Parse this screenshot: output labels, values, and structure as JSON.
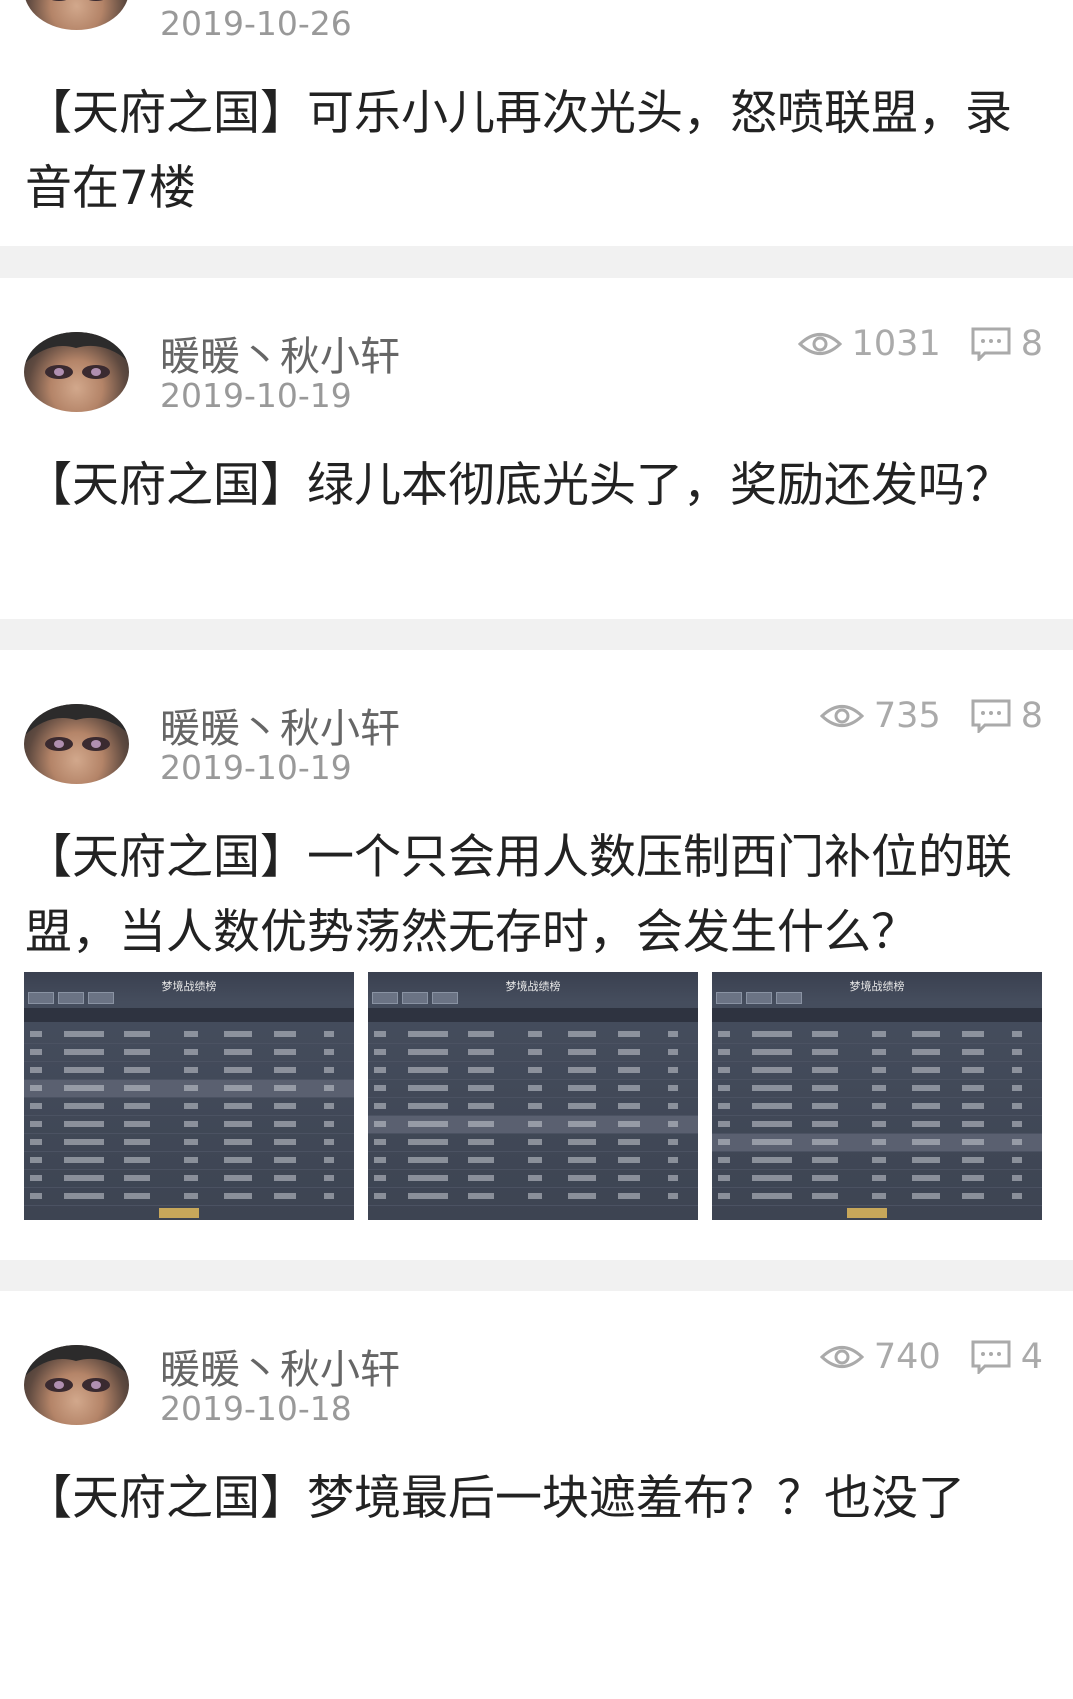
{
  "posts": [
    {
      "date": "2019-10-26",
      "title": "【天府之国】可乐小儿再次光头，怒喷联盟，录音在7楼"
    },
    {
      "author": "暖暖丶秋小轩",
      "date": "2019-10-19",
      "views": "1031",
      "comments": "8",
      "title": "【天府之国】绿儿本彻底光头了，奖励还发吗？"
    },
    {
      "author": "暖暖丶秋小轩",
      "date": "2019-10-19",
      "views": "735",
      "comments": "8",
      "title": "【天府之国】一个只会用人数压制西门补位的联盟，当人数优势荡然无存时，会发生什么？",
      "images": [
        {
          "caption": "梦境战绩榜"
        },
        {
          "caption": "梦境战绩榜"
        },
        {
          "caption": "梦境战绩榜"
        }
      ]
    },
    {
      "author": "暖暖丶秋小轩",
      "date": "2019-10-18",
      "views": "740",
      "comments": "4",
      "title": "【天府之国】梦境最后一块遮羞布？？也没了"
    }
  ],
  "colors": {
    "accent": "#e0312e",
    "title": "#222222",
    "meta": "#999999"
  }
}
